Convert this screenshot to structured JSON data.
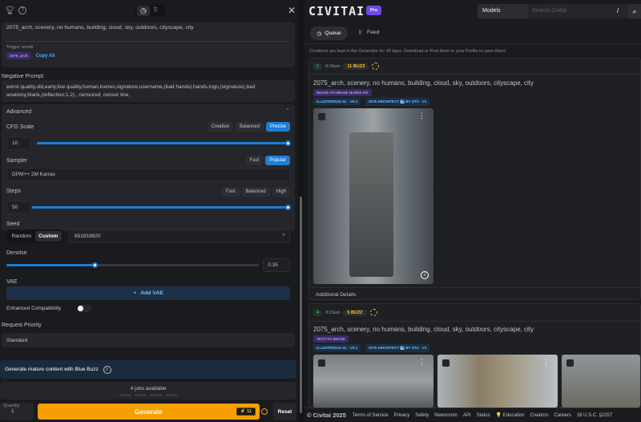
{
  "left": {
    "prompt": "2075_arch, scenery, no humans, building, cloud, sky, outdoors, cityscape, city",
    "trigger_label": "Trigger words",
    "trigger_word": "2075_arch",
    "copy_all": "Copy All",
    "negative_label": "Negative Prompt",
    "negative": "worst quality,old,early,low quality,human,lowres,signature,username,(bad hands),hands,logo,(signature),bad anatomy,blank,(reflection:1.2),, censored, censor line,",
    "advanced": "Advanced",
    "cfg": {
      "label": "CFG Scale",
      "value": "10",
      "presets": [
        "Creative",
        "Balanced",
        "Precise"
      ],
      "active": "Precise",
      "fraction": 1.0
    },
    "sampler": {
      "label": "Sampler",
      "value": "DPM++ 2M Karras",
      "presets": [
        "Fast",
        "Popular"
      ]
    },
    "steps": {
      "label": "Steps",
      "value": "50",
      "presets": [
        "Fast",
        "Balanced",
        "High"
      ],
      "fraction": 1.0
    },
    "seed": {
      "label": "Seed",
      "modes": [
        "Random",
        "Custom"
      ],
      "value": "651818820"
    },
    "denoise": {
      "label": "Denoise",
      "value": "0.35",
      "fraction": 0.35
    },
    "vae": {
      "label": "VAE",
      "add": "Add VAE"
    },
    "enhanced": "Enhanced Compatibility",
    "priority": {
      "label": "Request Priority",
      "value": "Standard"
    },
    "banner": "Generate mature content with Blue Buzz",
    "jobs": "4 jobs available",
    "quantity": {
      "label": "Quantity",
      "value": "1"
    },
    "generate": "Generate",
    "cost": "11",
    "reset": "Reset"
  },
  "right": {
    "logo": "CIVITAI",
    "pro": "Pro",
    "search_scope": "Models",
    "search_placeholder": "Search Civitai",
    "shortcut": "/",
    "tabs": [
      "Queue",
      "Feed"
    ],
    "notice": "Creations are kept in the Generator for 30 days. Download or Post them to your Profile to save them!",
    "cards": [
      {
        "count": "1",
        "time": "8:28am",
        "buzz": "11 BUZZ",
        "prompt": "2075_arch, scenery, no humans, building, cloud, sky, outdoors, cityscape, city",
        "type": "IMAGE-TO-IMAGE HI-RES FIX",
        "models": [
          "ILLUSTRIOUS-XL - V0.1",
          "2075 ARCHITECT 🏙 BY STX - V1"
        ],
        "details": "Additional Details"
      },
      {
        "count": "4",
        "time": "8:23am",
        "buzz": "5 BUZZ",
        "prompt": "2075_arch, scenery, no humans, building, cloud, sky, outdoors, cityscape, city",
        "type": "TEXT-TO-IMAGE",
        "models": [
          "ILLUSTRIOUS-XL - V0.1",
          "2075 ARCHITECT 🏙 BY STX - V1"
        ]
      }
    ],
    "footer": [
      "© Civitai 2025",
      "Terms of Service",
      "Privacy",
      "Safety",
      "Newsroom",
      "API",
      "Status",
      "💡 Education",
      "Creators",
      "Careers",
      "18 U.S.C. §2257"
    ]
  }
}
